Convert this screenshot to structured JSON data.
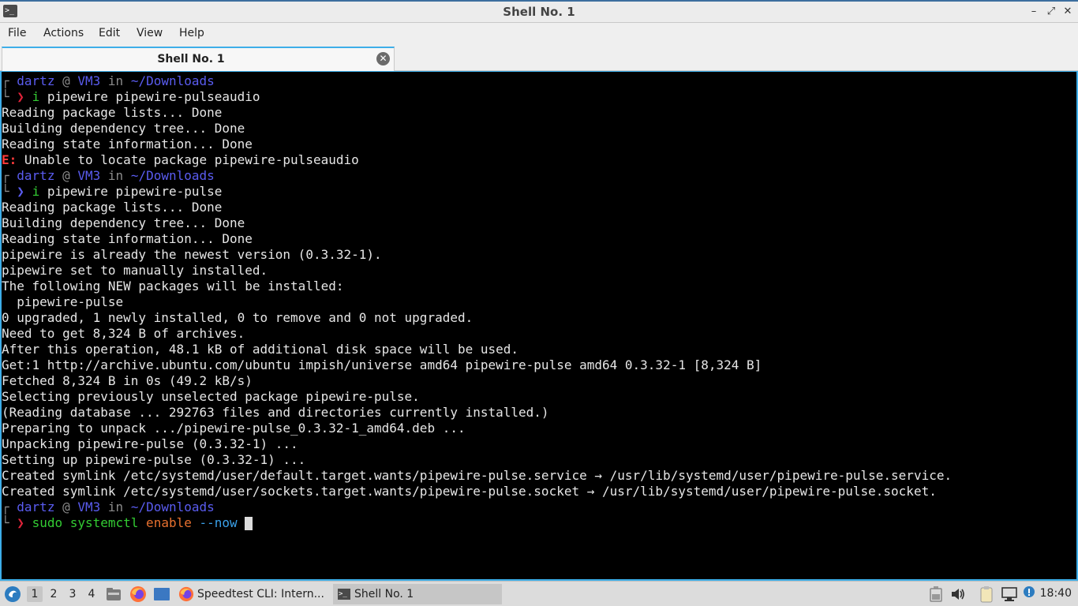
{
  "window": {
    "title": "Shell No. 1",
    "controls": {
      "minimize": "–",
      "restore": "⤢",
      "close": "✕"
    }
  },
  "menubar": {
    "items": [
      "File",
      "Actions",
      "Edit",
      "View",
      "Help"
    ]
  },
  "tabs": [
    {
      "label": "Shell No. 1",
      "close": "✕"
    }
  ],
  "terminal": {
    "prompt": {
      "user": "dartz",
      "at": "@",
      "host": "VM3",
      "in": "in",
      "path": "~/Downloads",
      "corner_top": "┌",
      "corner_bottom": "└",
      "arrow": "❯"
    },
    "session": [
      {
        "type": "prompt",
        "arrow_color": "red",
        "cmd": "i",
        "args": " pipewire pipewire-pulseaudio"
      },
      {
        "type": "out",
        "text": "Reading package lists... Done"
      },
      {
        "type": "out",
        "text": "Building dependency tree... Done"
      },
      {
        "type": "out",
        "text": "Reading state information... Done"
      },
      {
        "type": "err",
        "prefix": "E:",
        "text": " Unable to locate package pipewire-pulseaudio"
      },
      {
        "type": "prompt",
        "arrow_color": "blue",
        "cmd": "i",
        "args": " pipewire pipewire-pulse"
      },
      {
        "type": "out",
        "text": "Reading package lists... Done"
      },
      {
        "type": "out",
        "text": "Building dependency tree... Done"
      },
      {
        "type": "out",
        "text": "Reading state information... Done"
      },
      {
        "type": "out",
        "text": "pipewire is already the newest version (0.3.32-1)."
      },
      {
        "type": "out",
        "text": "pipewire set to manually installed."
      },
      {
        "type": "out",
        "text": "The following NEW packages will be installed:"
      },
      {
        "type": "out",
        "text": "  pipewire-pulse"
      },
      {
        "type": "out",
        "text": "0 upgraded, 1 newly installed, 0 to remove and 0 not upgraded."
      },
      {
        "type": "out",
        "text": "Need to get 8,324 B of archives."
      },
      {
        "type": "out",
        "text": "After this operation, 48.1 kB of additional disk space will be used."
      },
      {
        "type": "out",
        "text": "Get:1 http://archive.ubuntu.com/ubuntu impish/universe amd64 pipewire-pulse amd64 0.3.32-1 [8,324 B]"
      },
      {
        "type": "out",
        "text": "Fetched 8,324 B in 0s (49.2 kB/s)"
      },
      {
        "type": "out",
        "text": "Selecting previously unselected package pipewire-pulse."
      },
      {
        "type": "out",
        "text": "(Reading database ... 292763 files and directories currently installed.)"
      },
      {
        "type": "out",
        "text": "Preparing to unpack .../pipewire-pulse_0.3.32-1_amd64.deb ..."
      },
      {
        "type": "out",
        "text": "Unpacking pipewire-pulse (0.3.32-1) ..."
      },
      {
        "type": "out",
        "text": "Setting up pipewire-pulse (0.3.32-1) ..."
      },
      {
        "type": "out",
        "text": "Created symlink /etc/systemd/user/default.target.wants/pipewire-pulse.service → /usr/lib/systemd/user/pipewire-pulse.service."
      },
      {
        "type": "out",
        "text": "Created symlink /etc/systemd/user/sockets.target.wants/pipewire-pulse.socket → /usr/lib/systemd/user/pipewire-pulse.socket."
      },
      {
        "type": "current",
        "arrow_color": "red",
        "cmd": "sudo systemctl",
        "sub": " enable",
        "flag": " --now"
      }
    ]
  },
  "taskbar": {
    "workspaces": [
      "1",
      "2",
      "3",
      "4"
    ],
    "active_workspace": "1",
    "tasks": [
      {
        "label": "Speedtest CLI: Intern...",
        "icon": "firefox-icon",
        "active": false
      },
      {
        "label": "Shell No. 1",
        "icon": "terminal-icon",
        "active": true
      }
    ],
    "clock": "18:40",
    "colors": {
      "accent": "#3daee9",
      "firefox": "#ff7139"
    }
  }
}
